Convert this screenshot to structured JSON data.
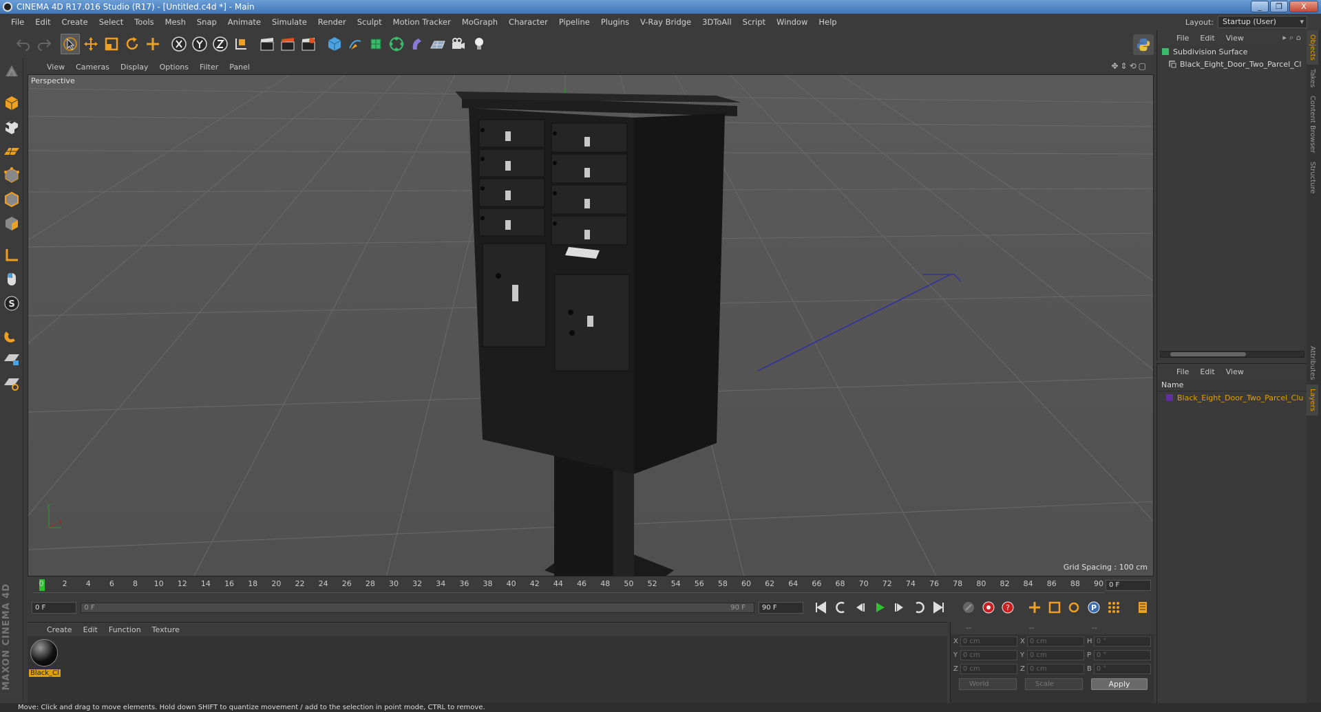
{
  "window": {
    "title": "CINEMA 4D R17.016 Studio (R17) - [Untitled.c4d *] - Main",
    "buttons": [
      "_",
      "❐",
      "X"
    ]
  },
  "menubar": {
    "items": [
      "File",
      "Edit",
      "Create",
      "Select",
      "Tools",
      "Mesh",
      "Snap",
      "Animate",
      "Simulate",
      "Render",
      "Sculpt",
      "Motion Tracker",
      "MoGraph",
      "Character",
      "Pipeline",
      "Plugins",
      "V-Ray Bridge",
      "3DToAll",
      "Script",
      "Window",
      "Help"
    ],
    "layout_label": "Layout:",
    "layout_value": "Startup (User)"
  },
  "viewport": {
    "menu": [
      "View",
      "Cameras",
      "Display",
      "Options",
      "Filter",
      "Panel"
    ],
    "label": "Perspective",
    "grid_spacing": "Grid Spacing : 100 cm"
  },
  "timeline": {
    "ticks": [
      "0",
      "2",
      "4",
      "6",
      "8",
      "10",
      "12",
      "14",
      "16",
      "18",
      "20",
      "22",
      "24",
      "26",
      "28",
      "30",
      "32",
      "34",
      "36",
      "38",
      "40",
      "42",
      "44",
      "46",
      "48",
      "50",
      "52",
      "54",
      "56",
      "58",
      "60",
      "62",
      "64",
      "66",
      "68",
      "70",
      "72",
      "74",
      "76",
      "78",
      "80",
      "82",
      "84",
      "86",
      "88",
      "90"
    ],
    "current_frame": "0 F",
    "start_field": "0 F",
    "slider_start": "0 F",
    "slider_end": "90 F",
    "end_field": "90 F"
  },
  "material_manager": {
    "menu": [
      "Create",
      "Edit",
      "Function",
      "Texture"
    ],
    "material_name": "Black_Cl"
  },
  "coordinates": {
    "header": [
      "--",
      "--",
      "--"
    ],
    "rows": [
      {
        "a1": "X",
        "v1": "0 cm",
        "a2": "X",
        "v2": "0 cm",
        "a3": "H",
        "v3": "0 °"
      },
      {
        "a1": "Y",
        "v1": "0 cm",
        "a2": "Y",
        "v2": "0 cm",
        "a3": "P",
        "v3": "0 °"
      },
      {
        "a1": "Z",
        "v1": "0 cm",
        "a2": "Z",
        "v2": "0 cm",
        "a3": "B",
        "v3": "0 °"
      }
    ],
    "space": "World",
    "mode": "Scale",
    "apply": "Apply"
  },
  "object_manager": {
    "menu": [
      "File",
      "Edit",
      "View"
    ],
    "objects": [
      "Subdivision Surface",
      "Black_Eight_Door_Two_Parcel_Cl"
    ]
  },
  "layer_manager": {
    "menu": [
      "File",
      "Edit",
      "View"
    ],
    "column": "Name",
    "layers": [
      "Black_Eight_Door_Two_Parcel_Clu"
    ]
  },
  "side_tabs": [
    "Objects",
    "Takes",
    "Content Browser",
    "Structure",
    "Attributes",
    "Layers"
  ],
  "status": "Move: Click and drag to move elements. Hold down SHIFT to quantize movement / add to the selection in point mode, CTRL to remove.",
  "brand": "MAXON CINEMA 4D",
  "colors": {
    "accent": "#e0a000",
    "playhead": "#2fc22f",
    "title": "#3e74b6"
  }
}
